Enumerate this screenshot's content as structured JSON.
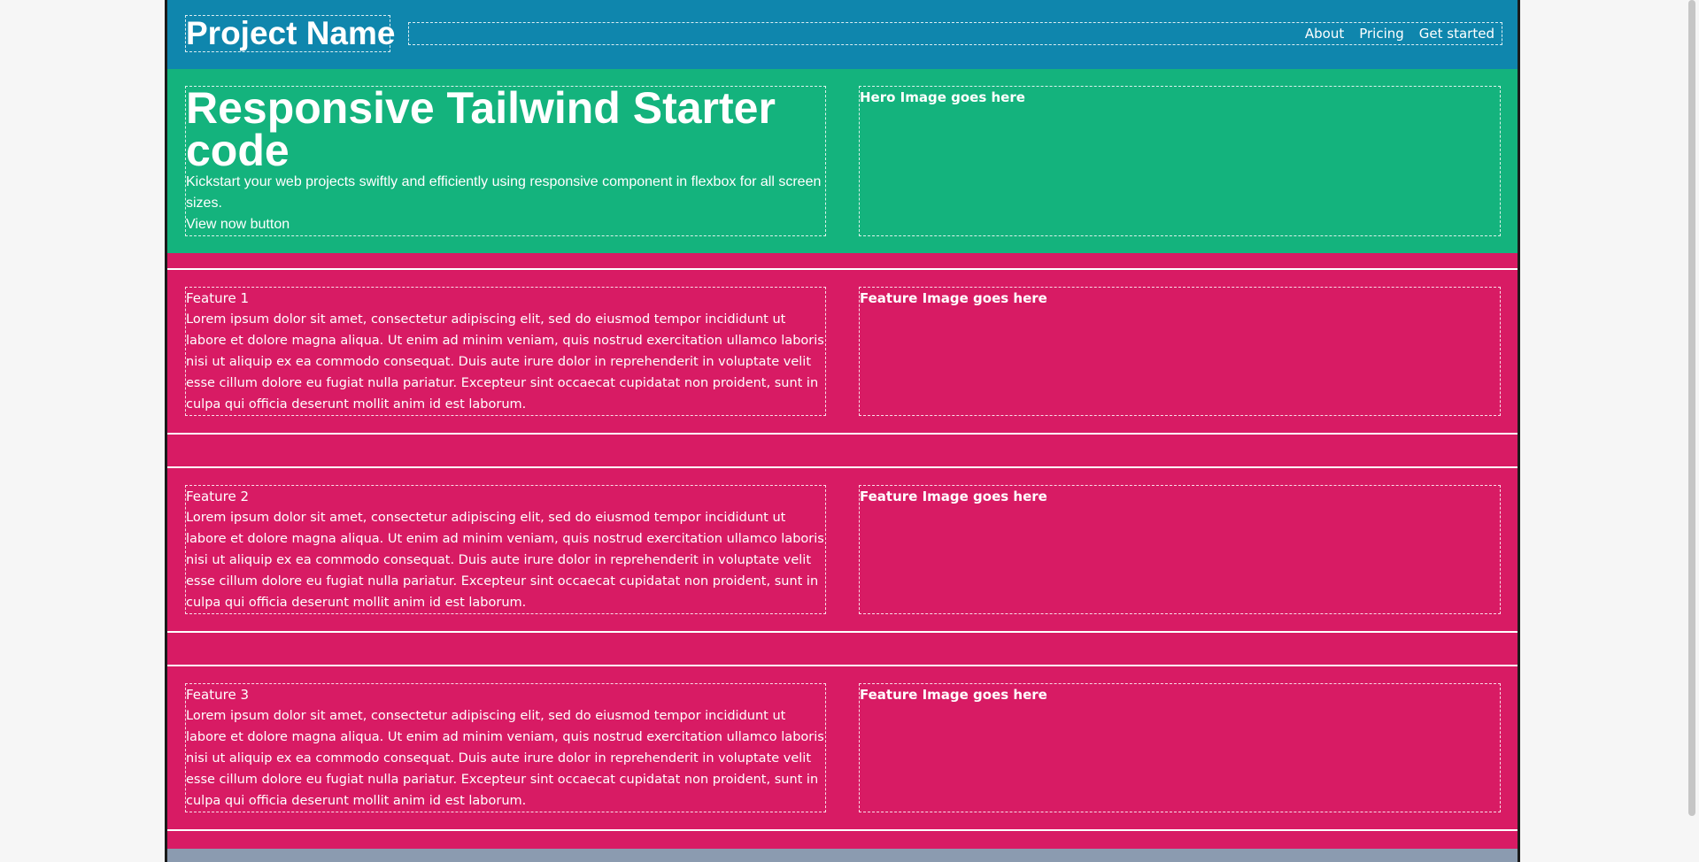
{
  "header": {
    "brand": "Project Name",
    "nav": [
      "About",
      "Pricing",
      "Get started"
    ]
  },
  "hero": {
    "title": "Responsive Tailwind Starter code",
    "description": "Kickstart your web projects swiftly and efficiently using responsive component in flexbox for all screen sizes.",
    "button": "View now button",
    "image_placeholder": "Hero Image goes here"
  },
  "features": [
    {
      "title": "Feature 1",
      "body": "Lorem ipsum dolor sit amet, consectetur adipiscing elit, sed do eiusmod tempor incididunt ut labore et dolore magna aliqua. Ut enim ad minim veniam, quis nostrud exercitation ullamco laboris nisi ut aliquip ex ea commodo consequat. Duis aute irure dolor in reprehenderit in voluptate velit esse cillum dolore eu fugiat nulla pariatur. Excepteur sint occaecat cupidatat non proident, sunt in culpa qui officia deserunt mollit anim id est laborum.",
      "image_placeholder": "Feature Image goes here"
    },
    {
      "title": "Feature 2",
      "body": "Lorem ipsum dolor sit amet, consectetur adipiscing elit, sed do eiusmod tempor incididunt ut labore et dolore magna aliqua. Ut enim ad minim veniam, quis nostrud exercitation ullamco laboris nisi ut aliquip ex ea commodo consequat. Duis aute irure dolor in reprehenderit in voluptate velit esse cillum dolore eu fugiat nulla pariatur. Excepteur sint occaecat cupidatat non proident, sunt in culpa qui officia deserunt mollit anim id est laborum.",
      "image_placeholder": "Feature Image goes here"
    },
    {
      "title": "Feature 3",
      "body": "Lorem ipsum dolor sit amet, consectetur adipiscing elit, sed do eiusmod tempor incididunt ut labore et dolore magna aliqua. Ut enim ad minim veniam, quis nostrud exercitation ullamco laboris nisi ut aliquip ex ea commodo consequat. Duis aute irure dolor in reprehenderit in voluptate velit esse cillum dolore eu fugiat nulla pariatur. Excepteur sint occaecat cupidatat non proident, sunt in culpa qui officia deserunt mollit anim id est laborum.",
      "image_placeholder": "Feature Image goes here"
    }
  ],
  "colors": {
    "header_bg": "#0f86ad",
    "hero_bg": "#14b37d",
    "feature_bg": "#d81b64",
    "footer_bg": "#8b9bb0"
  }
}
